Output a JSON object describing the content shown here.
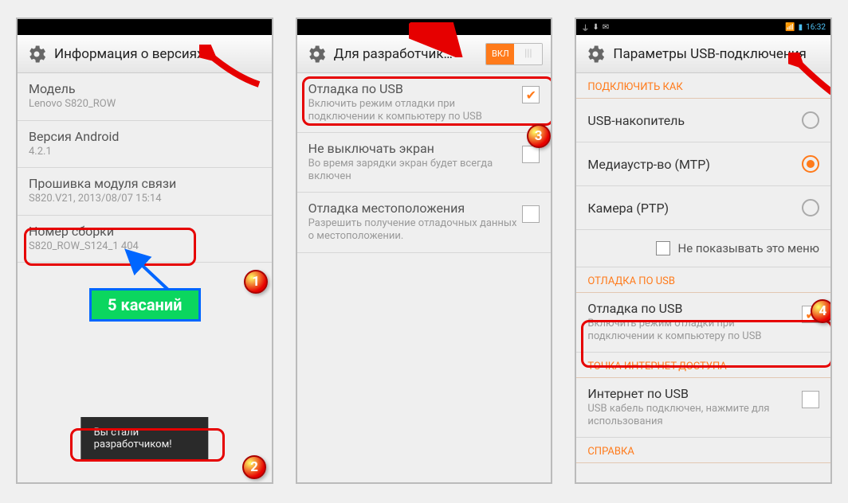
{
  "screen1": {
    "header_title": "Информация о версиях",
    "model_label": "Модель",
    "model_value": "Lenovo S820_ROW",
    "android_label": "Версия Android",
    "android_value": "4.2.1",
    "baseband_label": "Прошивка модуля связи",
    "baseband_value": "S820.V21, 2013/08/07 15:14",
    "build_label": "Номер сборки",
    "build_value": "S820_ROW_S124_1   404",
    "toast": "Вы стали разработчиком!",
    "hint": "5 касаний"
  },
  "screen2": {
    "header_title": "Для разработчик…",
    "toggle_on": "ВКЛ",
    "toggle_off": "|||",
    "usb_debug_title": "Отладка по USB",
    "usb_debug_sub": "Включить режим отладки при подключении к компьютеру по USB",
    "stay_awake_title": "Не выключать экран",
    "stay_awake_sub": "Во время зарядки экран будет всегда включен",
    "mock_loc_title": "Отладка местоположения",
    "mock_loc_sub": "Разрешить получение отладочных данных о местоположении."
  },
  "screen3": {
    "status_time": "16:32",
    "header_title": "Параметры USB-подключения",
    "connect_as": "ПОДКЛЮЧИТЬ КАК",
    "opt_storage": "USB-накопитель",
    "opt_mtp": "Медиаустр-во (MTP)",
    "opt_ptp": "Камера (PTP)",
    "dont_show": "Не показывать это меню",
    "section_usb": "ОТЛАДКА ПО USB",
    "usb_debug_title": "Отладка по USB",
    "usb_debug_sub": "Включить режим отладки при подключении к компьютеру по USB",
    "section_tether": "ТОЧКА ИНТЕРНЕТ-ДОСТУПА",
    "tether_title": "Интернет по USB",
    "tether_sub": "USB кабель подключен, нажмите для использования",
    "section_help": "СПРАВКА"
  },
  "badges": {
    "b1": "1",
    "b2": "2",
    "b3": "3",
    "b4": "4"
  }
}
